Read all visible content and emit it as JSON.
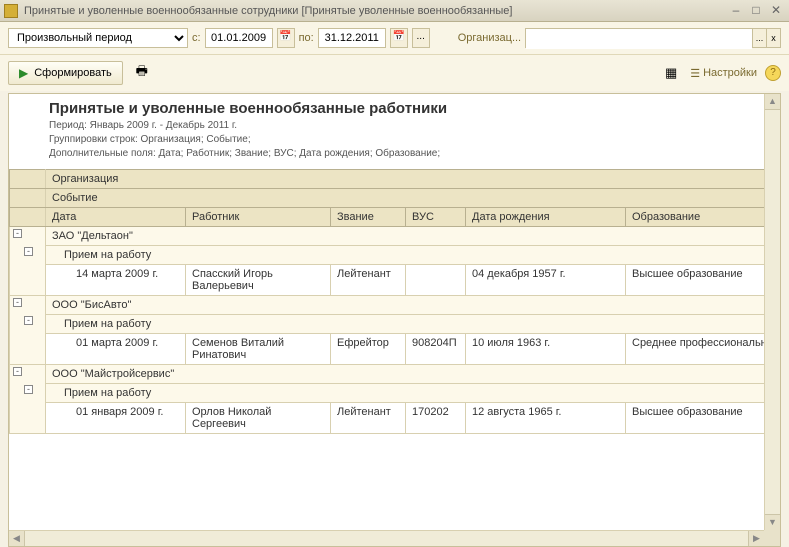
{
  "window": {
    "title": "Принятые и уволенные военнообязанные сотрудники [Принятые уволенные военнообязанные]"
  },
  "filter": {
    "period_type": "Произвольный период",
    "from_lbl": "с:",
    "from_date": "01.01.2009",
    "to_lbl": "по:",
    "to_date": "31.12.2011",
    "org_lbl": "Организац...",
    "org_value": "",
    "dots": "...",
    "x": "x"
  },
  "toolbar": {
    "form_btn": "Сформировать",
    "settings": "Настройки"
  },
  "report": {
    "title": "Принятые и уволенные военнообязанные работники",
    "meta1": "Период: Январь 2009 г. - Декабрь 2011 г.",
    "meta2": "Группировки строк: Организация; Событие;",
    "meta3": "Дополнительные поля: Дата; Работник; Звание; ВУС; Дата рождения; Образование;",
    "hdr_org": "Организация",
    "hdr_event": "Событие",
    "cols": {
      "date": "Дата",
      "worker": "Работник",
      "rank": "Звание",
      "vus": "ВУС",
      "bdate": "Дата рождения",
      "edu": "Образование"
    },
    "groups": [
      {
        "org": "ЗАО \"Дельтаон\"",
        "event": "Прием на работу",
        "rows": [
          {
            "date": "14 марта 2009 г.",
            "worker": "Спасский Игорь Валерьевич",
            "rank": "Лейтенант",
            "vus": "",
            "bdate": "04 декабря 1957 г.",
            "edu": "Высшее образование"
          }
        ]
      },
      {
        "org": "ООО \"БисАвто\"",
        "event": "Прием на работу",
        "rows": [
          {
            "date": "01 марта 2009 г.",
            "worker": "Семенов Виталий Ринатович",
            "rank": "Ефрейтор",
            "vus": "908204П",
            "bdate": "10 июля 1963 г.",
            "edu": "Среднее профессиональн"
          }
        ]
      },
      {
        "org": "ООО \"Майстройсервис\"",
        "event": "Прием на работу",
        "rows": [
          {
            "date": "01 января 2009 г.",
            "worker": "Орлов Николай Сергеевич",
            "rank": "Лейтенант",
            "vus": "170202",
            "bdate": "12 августа 1965 г.",
            "edu": "Высшее образование"
          }
        ]
      }
    ]
  }
}
